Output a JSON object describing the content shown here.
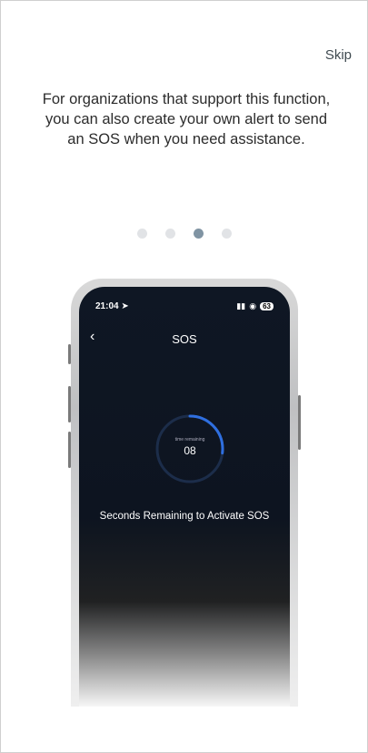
{
  "onboarding": {
    "skip_label": "Skip",
    "description": "For organizations that support this function, you can also create your own alert to send an SOS when you need assistance.",
    "pager": {
      "total": 4,
      "active_index": 2
    }
  },
  "phone": {
    "status_bar": {
      "time": "21:04",
      "battery": "63"
    },
    "nav": {
      "back_icon": "chevron-left-icon",
      "title": "SOS"
    },
    "timer": {
      "label": "time remaining",
      "value": "08",
      "progress": 0.27
    },
    "message": "Seconds Remaining to Activate SOS"
  },
  "colors": {
    "dot_active": "#8094a3",
    "dot_inactive": "#e1e3e6",
    "ring_accent": "#2f6fe0",
    "ring_track": "#1c2d4a"
  }
}
